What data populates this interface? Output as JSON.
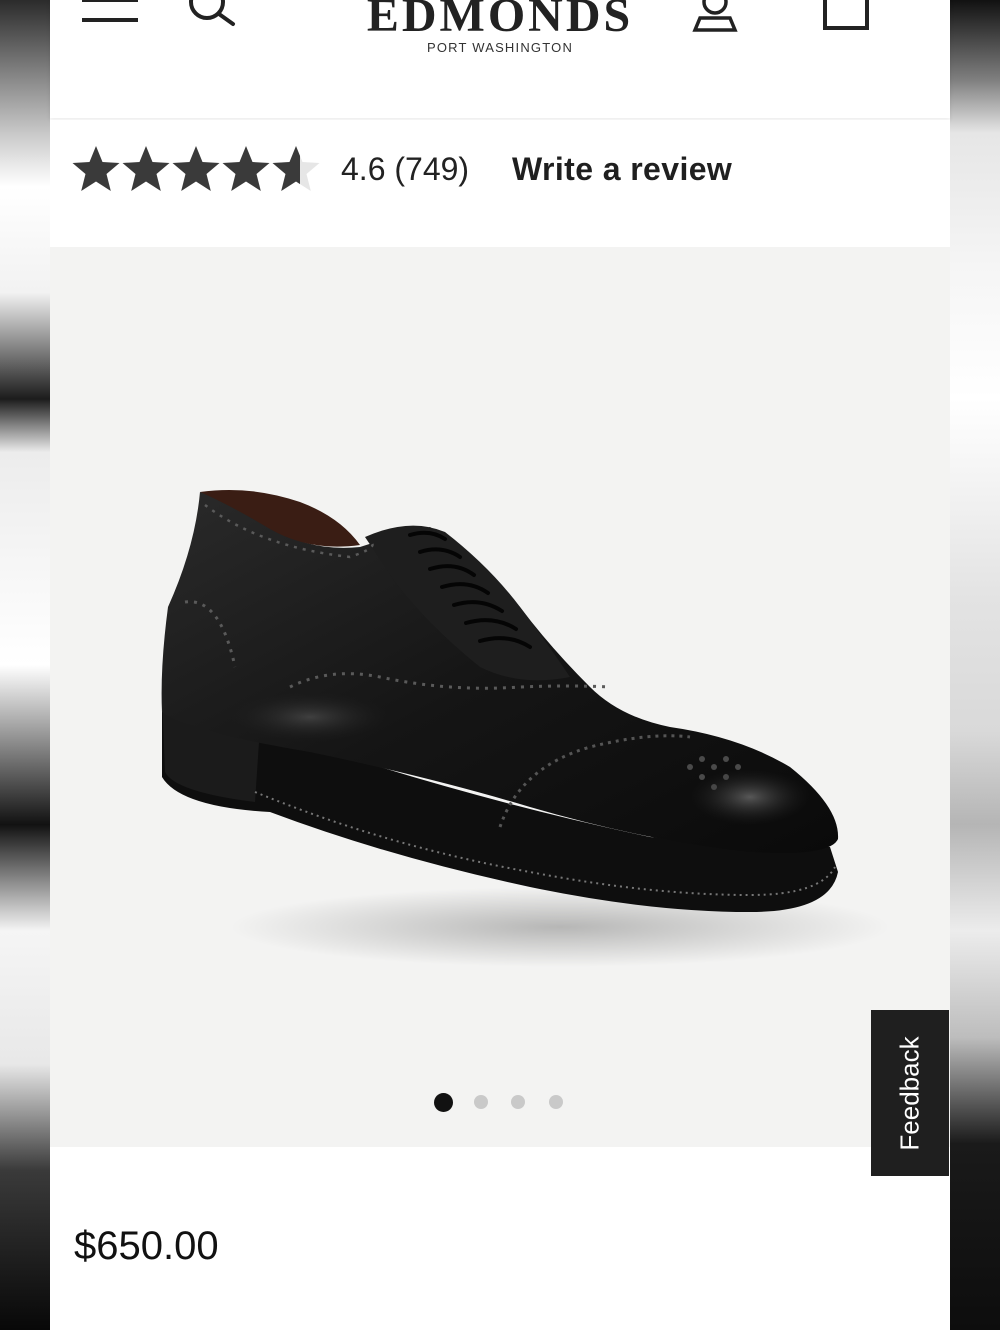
{
  "store": {
    "name": "EDMONDS",
    "location": "PORT WASHINGTON"
  },
  "header": {
    "menu_icon": "menu-icon",
    "search_icon": "search-icon",
    "account_icon": "account-icon",
    "cart_icon": "shopping-bag-icon"
  },
  "rating": {
    "value": 4.6,
    "max": 5,
    "text": "4.6 (749)",
    "write_review": "Write a review",
    "star_color": "#3a3a3a"
  },
  "gallery": {
    "image_description_icon": "black-leather-cap-toe-oxford-shoe",
    "dot_count": 4,
    "active_index": 0
  },
  "feedback_tab": "Feedback",
  "product": {
    "price": "$650.00"
  }
}
